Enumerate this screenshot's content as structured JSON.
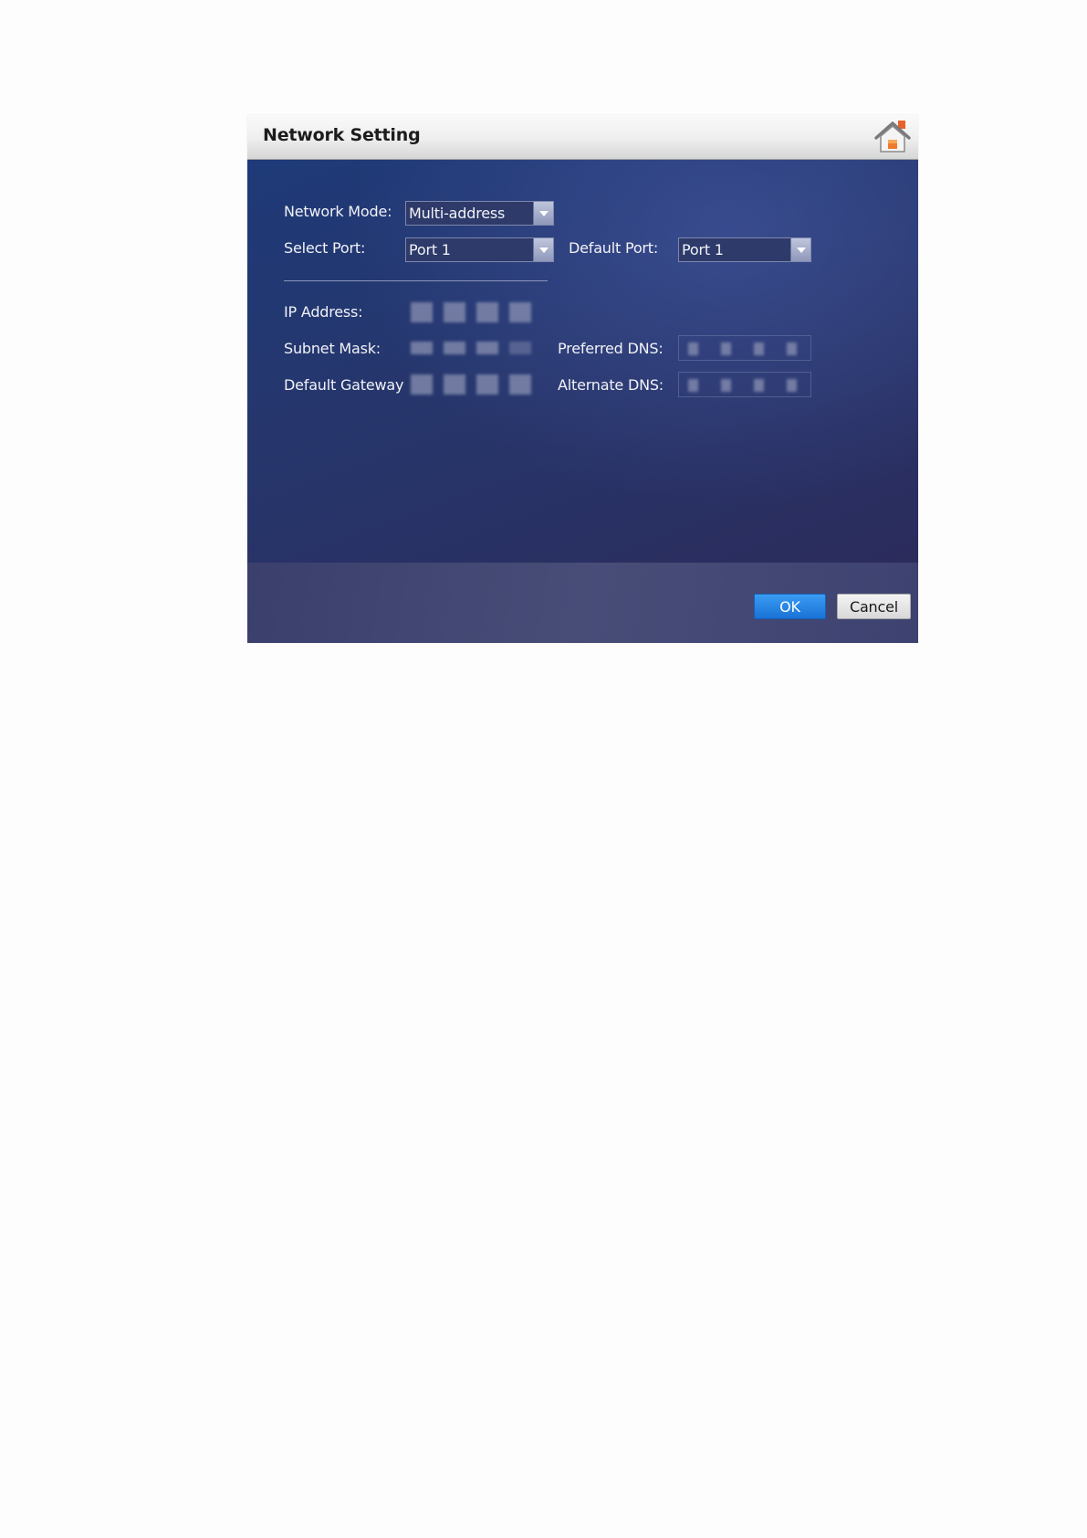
{
  "dialog": {
    "title": "Network Setting",
    "home_icon": "home-icon"
  },
  "form": {
    "network_mode": {
      "label": "Network Mode:",
      "value": "Multi-address"
    },
    "select_port": {
      "label": "Select Port:",
      "value": "Port 1"
    },
    "default_port": {
      "label": "Default Port:",
      "value": "Port 1"
    },
    "ip_address": {
      "label": "IP Address:"
    },
    "subnet_mask": {
      "label": "Subnet Mask:"
    },
    "default_gateway": {
      "label": "Default Gateway"
    },
    "preferred_dns": {
      "label": "Preferred DNS:"
    },
    "alternate_dns": {
      "label": "Alternate DNS:"
    }
  },
  "buttons": {
    "ok_label": "OK",
    "cancel_label": "Cancel"
  },
  "colors": {
    "accent": "#1a72d6",
    "panel_bg": "#26366c"
  }
}
